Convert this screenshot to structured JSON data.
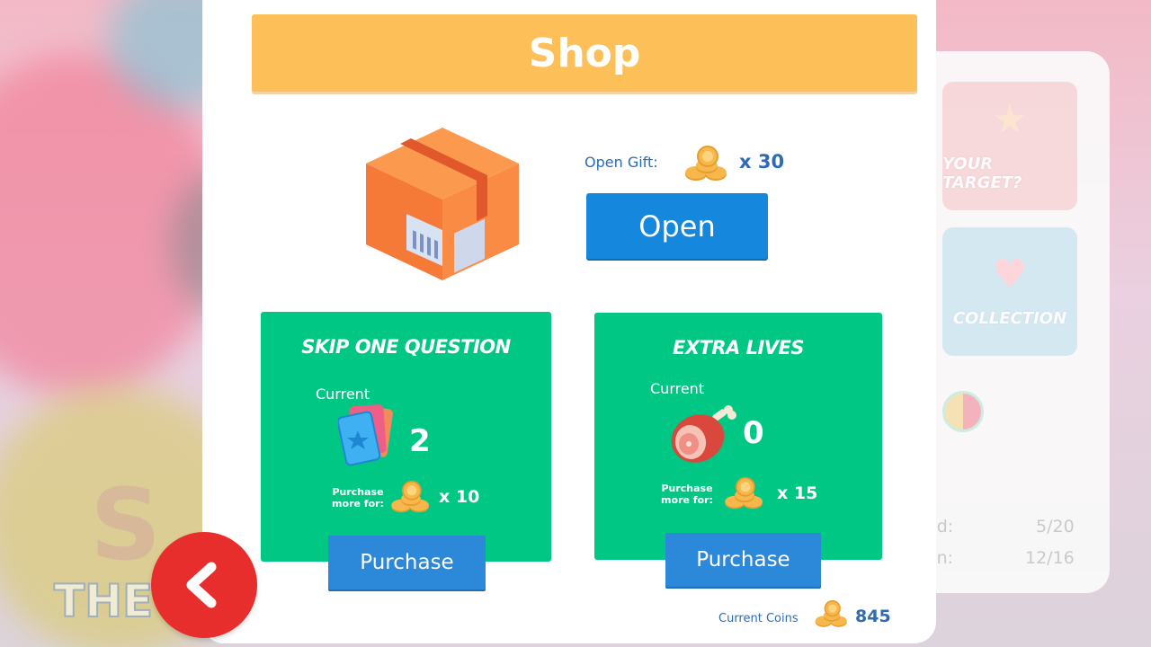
{
  "shop": {
    "title": "Shop",
    "gift": {
      "label": "Open Gift:",
      "price": "x 30",
      "button": "Open",
      "icon": "gift-box-icon"
    },
    "items": [
      {
        "title": "SKIP ONE QUESTION",
        "current_label": "Current",
        "current_value": "2",
        "icon": "question-cards-icon",
        "purchase_label": "Purchase more for:",
        "price": "x 10",
        "button": "Purchase"
      },
      {
        "title": "EXTRA LIVES",
        "current_label": "Current",
        "current_value": "0",
        "icon": "meat-drumstick-icon",
        "purchase_label": "Purchase more for:",
        "price": "x 15",
        "button": "Purchase"
      }
    ],
    "current_coins_label": "Current Coins",
    "current_coins_value": "845"
  },
  "side_panel": {
    "cards": [
      {
        "label": "YOUR TARGET?",
        "icon": "star-icon"
      },
      {
        "label": "COLLECTION",
        "icon": "heart-icon"
      }
    ],
    "stats": [
      {
        "label": "ed:",
        "value": "5/20"
      },
      {
        "label": "on:",
        "value": "12/16"
      }
    ]
  },
  "colors": {
    "title_bar": "#fdbf57",
    "card_green": "#00c783",
    "button_blue": "#1587dc",
    "text_blue": "#2d6cb3",
    "back_red": "#e82d2d"
  }
}
